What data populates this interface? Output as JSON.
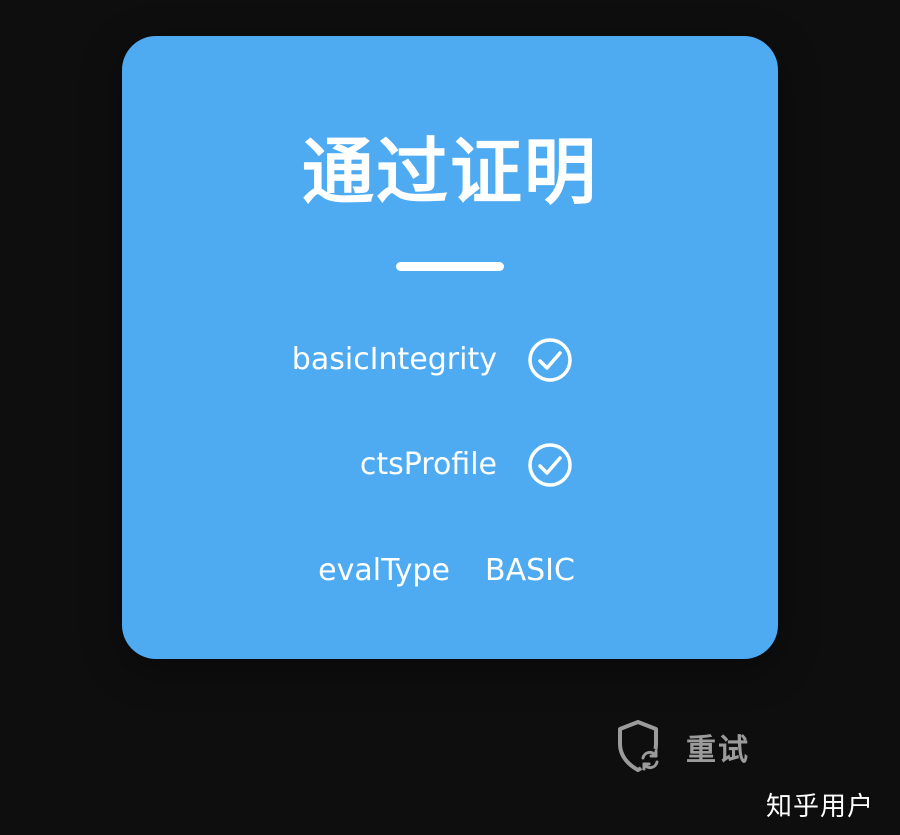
{
  "card": {
    "title": "通过证明",
    "rows": [
      {
        "label": "basicIntegrity",
        "status_icon": "check-circle-icon"
      },
      {
        "label": "ctsProfile",
        "status_icon": "check-circle-icon"
      },
      {
        "label": "evalType",
        "value": "BASIC"
      }
    ]
  },
  "retry": {
    "icon": "shield-refresh-icon",
    "label": "重试"
  },
  "watermark": "知乎用户",
  "colors": {
    "background": "#0e0e0e",
    "card": "#4eabf2",
    "text": "#ffffff",
    "retry": "#9b9b9b"
  }
}
